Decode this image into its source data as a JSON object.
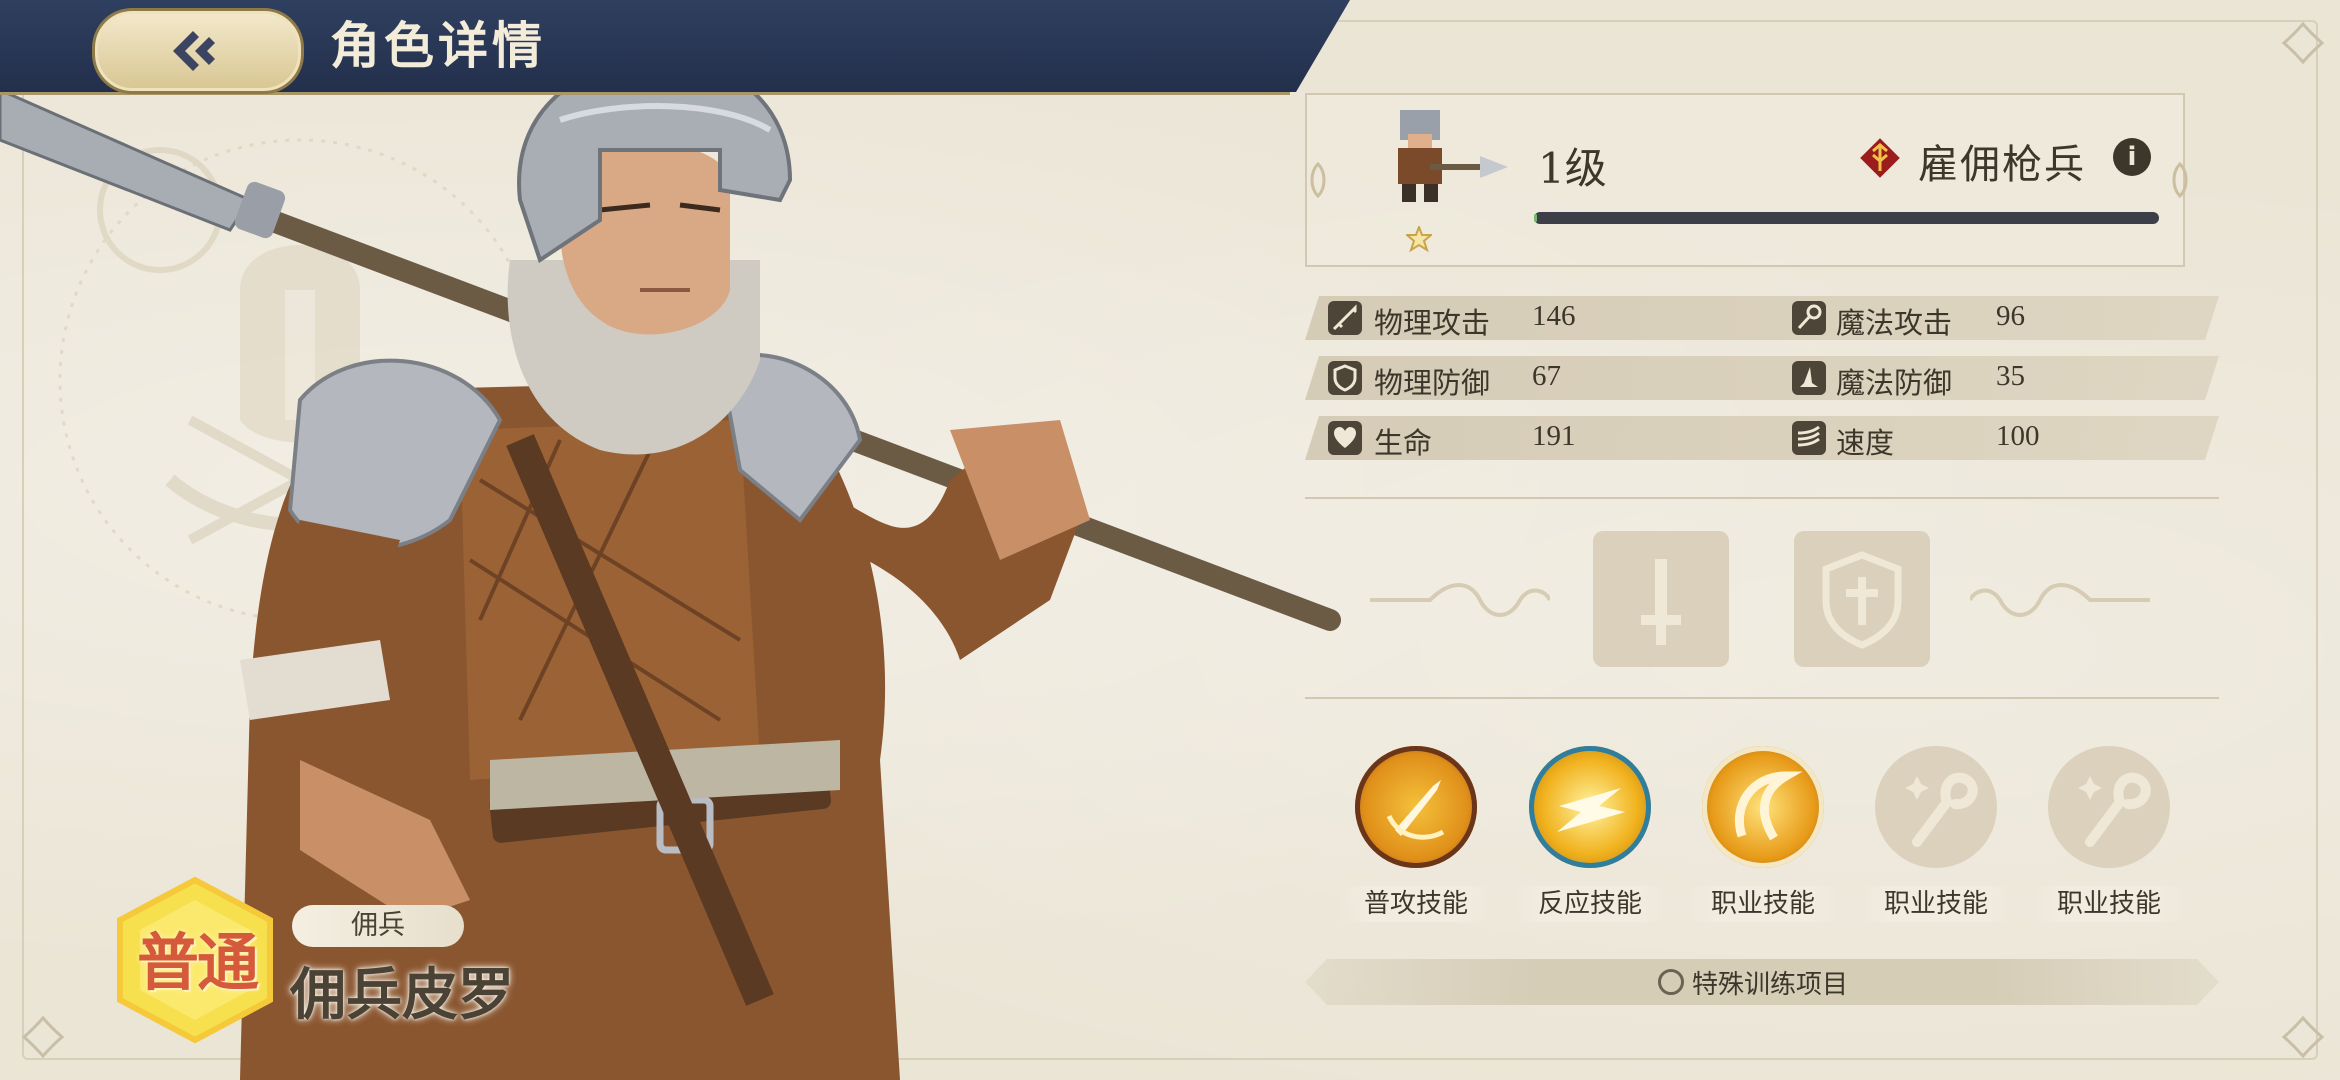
{
  "header": {
    "title": "角色详情",
    "back_icon": "back-arrow-icon"
  },
  "character": {
    "rarity": "普通",
    "class_tag": "佣兵",
    "name": "佣兵皮罗"
  },
  "info": {
    "level": "1级",
    "class_name": "雇佣枪兵",
    "info_icon_glyph": "i",
    "stars": 1,
    "exp_fraction": 0.005
  },
  "stats": [
    {
      "label": "物理攻击",
      "value": "146",
      "icon": "sword-icon"
    },
    {
      "label": "魔法攻击",
      "value": "96",
      "icon": "wand-icon"
    },
    {
      "label": "物理防御",
      "value": "67",
      "icon": "shield-icon"
    },
    {
      "label": "魔法防御",
      "value": "35",
      "icon": "wizard-hat-icon"
    },
    {
      "label": "生命",
      "value": "191",
      "icon": "heart-icon"
    },
    {
      "label": "速度",
      "value": "100",
      "icon": "wind-icon"
    }
  ],
  "equipment": [
    {
      "icon": "weapon-slot-icon"
    },
    {
      "icon": "armor-slot-icon"
    }
  ],
  "skills": [
    {
      "label": "普攻技能",
      "state": "unlocked"
    },
    {
      "label": "反应技能",
      "state": "unlocked"
    },
    {
      "label": "职业技能",
      "state": "unlocked"
    },
    {
      "label": "职业技能",
      "state": "locked"
    },
    {
      "label": "职业技能",
      "state": "locked"
    }
  ],
  "training": {
    "label": "特殊训练项目"
  },
  "colors": {
    "header_bg": "#2f3f5f",
    "paper": "#ebe5d6",
    "text_dark": "#3d362b",
    "rarity_red": "#d45a3b",
    "skill_gold": "#e8a21c"
  }
}
